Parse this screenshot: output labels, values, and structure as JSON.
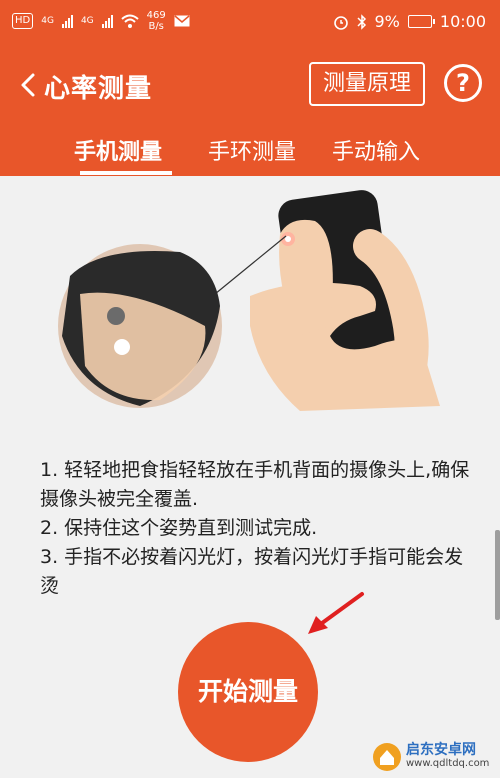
{
  "status_bar": {
    "hd": "HD",
    "sim1": "4G",
    "sim2": "4G",
    "net_speed_value": "469",
    "net_speed_unit": "B/s",
    "battery": "9%",
    "time": "10:00"
  },
  "header": {
    "title": "心率测量",
    "principle_button": "测量原理",
    "help_button": "?"
  },
  "tabs": [
    {
      "label": "手机测量",
      "active": true
    },
    {
      "label": "手环测量",
      "active": false
    },
    {
      "label": "手动输入",
      "active": false
    }
  ],
  "instructions": [
    "1. 轻轻地把食指轻轻放在手机背面的摄像头上,确保摄像头被完全覆盖.",
    "2. 保持住这个姿势直到测试完成.",
    "3. 手指不必按着闪光灯，按着闪光灯手指可能会发烫"
  ],
  "start_button": "开始测量",
  "watermark": {
    "line1": "启东安卓网",
    "line2": "www.qdltdq.com"
  },
  "colors": {
    "accent": "#e8562a",
    "arrow": "#e02020",
    "background": "#f1f1f1"
  }
}
